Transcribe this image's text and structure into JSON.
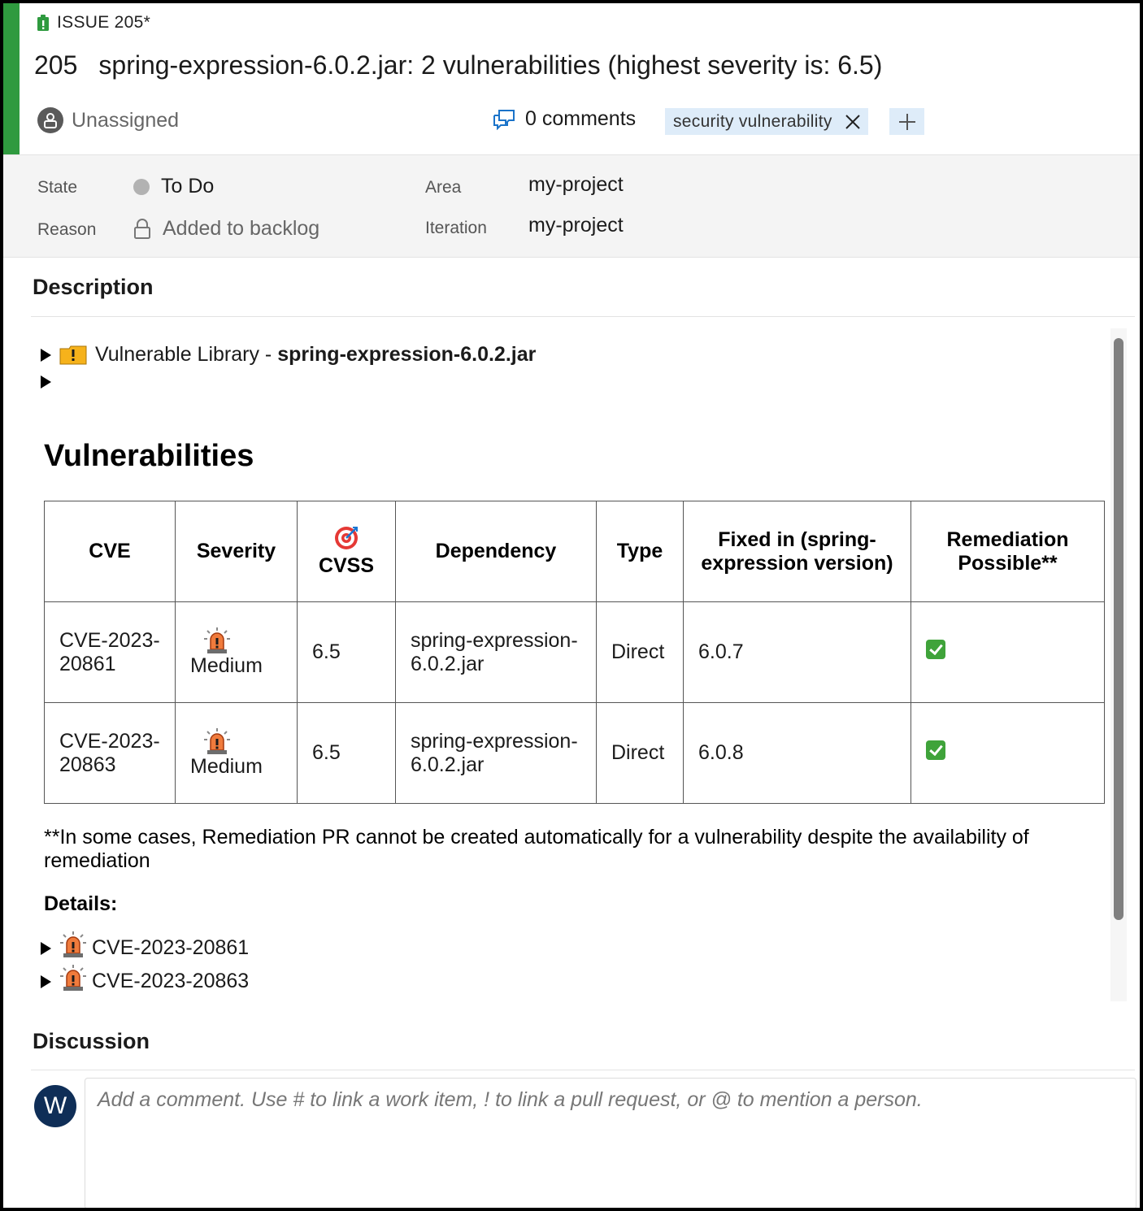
{
  "header": {
    "issue_type": "ISSUE 205*",
    "id": "205",
    "title": "spring-expression-6.0.2.jar: 2 vulnerabilities (highest severity is: 6.5)",
    "assignee": "Unassigned",
    "comments": "0 comments",
    "tags": [
      "security vulnerability"
    ],
    "accent_color": "#2f9a3f"
  },
  "fields": {
    "state_label": "State",
    "state_value": "To Do",
    "reason_label": "Reason",
    "reason_value": "Added to backlog",
    "area_label": "Area",
    "area_value": "my-project",
    "iteration_label": "Iteration",
    "iteration_value": "my-project"
  },
  "description": {
    "title": "Description",
    "library_prefix": "Vulnerable Library - ",
    "library_name": "spring-expression-6.0.2.jar",
    "vulnerabilities_heading": "Vulnerabilities",
    "table": {
      "headers": [
        "CVE",
        "Severity",
        "CVSS",
        "Dependency",
        "Type",
        "Fixed in (spring-expression version)",
        "Remediation Possible**"
      ],
      "rows": [
        {
          "cve": "CVE-2023-20861",
          "severity": "Medium",
          "cvss": "6.5",
          "dependency": "spring-expression-6.0.2.jar",
          "type": "Direct",
          "fixed_in": "6.0.7",
          "remediation": "check-mark"
        },
        {
          "cve": "CVE-2023-20863",
          "severity": "Medium",
          "cvss": "6.5",
          "dependency": "spring-expression-6.0.2.jar",
          "type": "Direct",
          "fixed_in": "6.0.8",
          "remediation": "check-mark"
        }
      ]
    },
    "note": "**In some cases, Remediation PR cannot be created automatically for a vulnerability despite the availability of remediation",
    "details_title": "Details:",
    "details": [
      "CVE-2023-20861",
      "CVE-2023-20863"
    ]
  },
  "discussion": {
    "title": "Discussion",
    "avatar_initial": "W",
    "comment_placeholder": "Add a comment. Use # to link a work item, ! to link a pull request, or @ to mention a person."
  },
  "icons": {
    "issue": "issue-icon",
    "warning": "warning-icon",
    "siren": "siren-icon",
    "target": "target-icon",
    "check": "check-icon"
  }
}
